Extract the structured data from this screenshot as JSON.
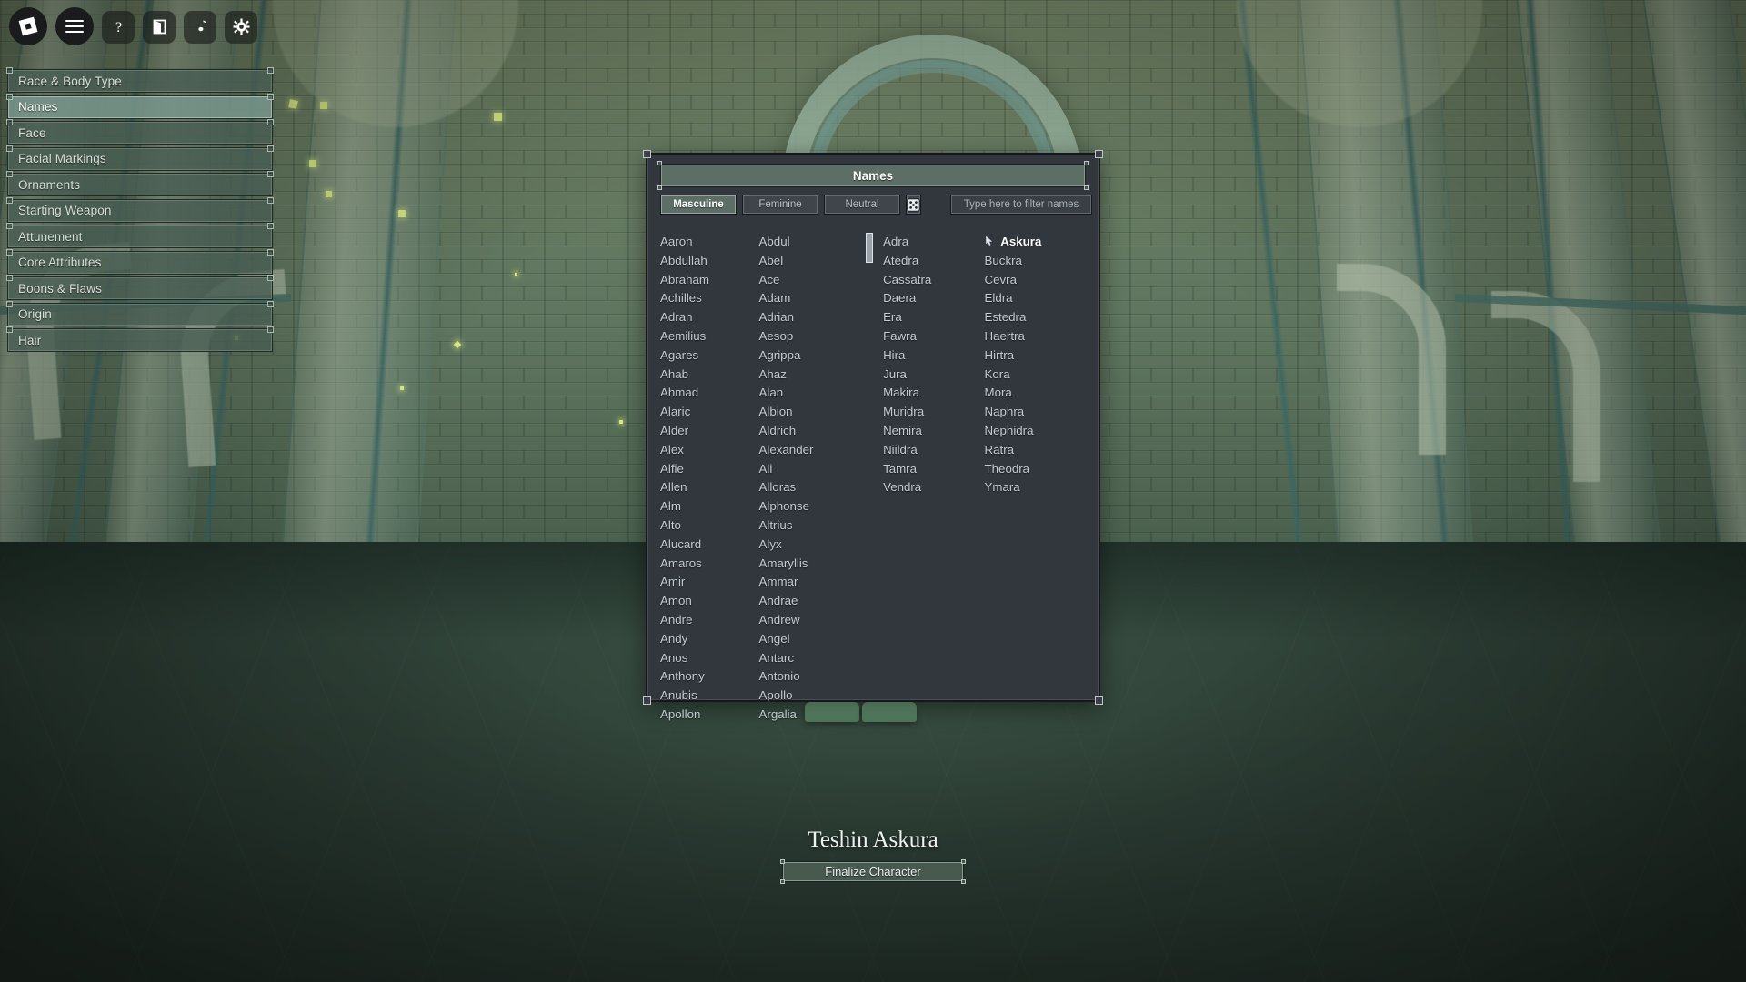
{
  "topbar": {
    "buttons": [
      {
        "name": "roblox-logo-icon",
        "label": "Roblox"
      },
      {
        "name": "menu-icon",
        "label": "Menu"
      },
      {
        "name": "help-icon",
        "label": "Help"
      },
      {
        "name": "exit-door-icon",
        "label": "Leave"
      },
      {
        "name": "music-note-icon",
        "label": "Music"
      },
      {
        "name": "gear-icon",
        "label": "Settings"
      }
    ]
  },
  "sidebar": {
    "items": [
      {
        "label": "Race & Body Type",
        "active": false
      },
      {
        "label": "Names",
        "active": true
      },
      {
        "label": "Face",
        "active": false
      },
      {
        "label": "Facial Markings",
        "active": false
      },
      {
        "label": "Ornaments",
        "active": false
      },
      {
        "label": "Starting Weapon",
        "active": false
      },
      {
        "label": "Attunement",
        "active": false
      },
      {
        "label": "Core Attributes",
        "active": false
      },
      {
        "label": "Boons & Flaws",
        "active": false
      },
      {
        "label": "Origin",
        "active": false
      },
      {
        "label": "Hair",
        "active": false
      }
    ]
  },
  "dialog": {
    "title": "Names",
    "tabs": [
      {
        "label": "Masculine",
        "active": true
      },
      {
        "label": "Feminine",
        "active": false
      },
      {
        "label": "Neutral",
        "active": false
      }
    ],
    "randomize": {
      "name": "dice-icon",
      "label": "Randomize"
    },
    "filter": {
      "placeholder": "Type here to filter names",
      "value": ""
    },
    "first_name_list": {
      "column_a": [
        "Aaron",
        "Abdullah",
        "Abraham",
        "Achilles",
        "Adran",
        "Aemilius",
        "Agares",
        "Ahab",
        "Ahmad",
        "Alaric",
        "Alder",
        "Alex",
        "Alfie",
        "Allen",
        "Alm",
        "Alto",
        "Alucard",
        "Amaros",
        "Amir",
        "Amon",
        "Andre",
        "Andy",
        "Anos",
        "Anthony",
        "Anubis",
        "Apollon"
      ],
      "column_b": [
        "Abdul",
        "Abel",
        "Ace",
        "Adam",
        "Adrian",
        "Aesop",
        "Agrippa",
        "Ahaz",
        "Alan",
        "Albion",
        "Aldrich",
        "Alexander",
        "Ali",
        "Alloras",
        "Alphonse",
        "Altrius",
        "Alyx",
        "Amaryllis",
        "Ammar",
        "Andrae",
        "Andrew",
        "Angel",
        "Antarc",
        "Antonio",
        "Apollo",
        "Argalia"
      ]
    },
    "surname_list": {
      "column_a": [
        "Adra",
        "Atedra",
        "Cassatra",
        "Daera",
        "Era",
        "Fawra",
        "Hira",
        "Jura",
        "Makira",
        "Muridra",
        "Nemira",
        "Niildra",
        "Tamra",
        "Vendra"
      ],
      "column_b": [
        "Askura",
        "Buckra",
        "Cevra",
        "Eldra",
        "Estedra",
        "Haertra",
        "Hirtra",
        "Kora",
        "Mora",
        "Naphra",
        "Nephidra",
        "Ratra",
        "Theodra",
        "Ymara"
      ]
    },
    "selected_surname": "Askura"
  },
  "footer": {
    "character_name": "Teshin Askura",
    "finalize_label": "Finalize Character"
  },
  "colors": {
    "accent_green": "#5c6e66",
    "panel_bg": "#32363d",
    "text_light": "#c3ccd3",
    "selected_white": "#ffffff",
    "spark": "#d8ea84"
  }
}
